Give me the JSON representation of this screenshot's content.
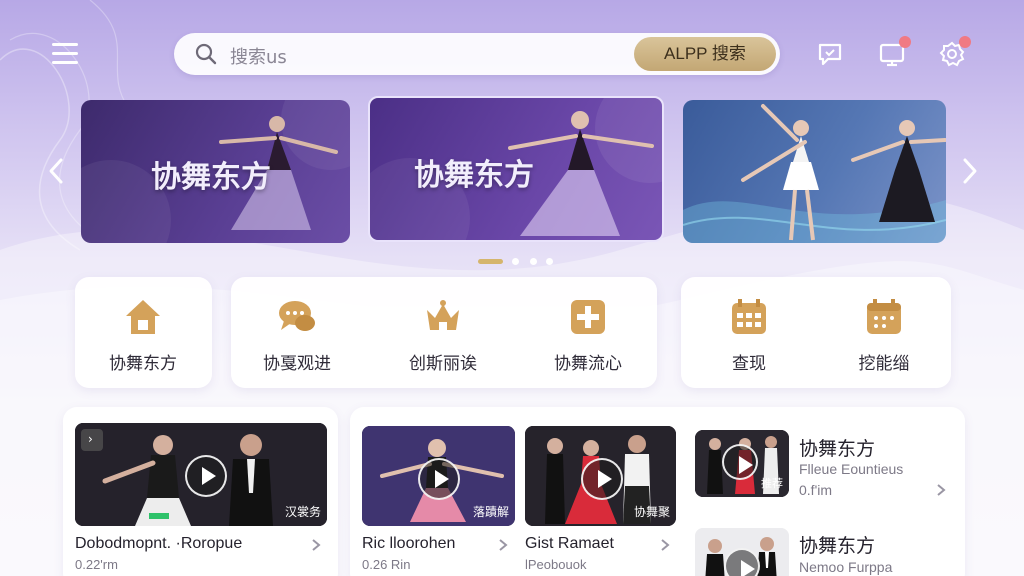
{
  "search": {
    "placeholder": "搜索us",
    "button_label": "ALPP 搜索"
  },
  "header_icons": [
    {
      "name": "chat-icon"
    },
    {
      "name": "tv-icon",
      "badge": ""
    },
    {
      "name": "settings-icon",
      "badge": ""
    }
  ],
  "carousel": {
    "banners": [
      {
        "text": "协舞东方"
      },
      {
        "text": "协舞东方"
      },
      {
        "text": ""
      }
    ],
    "dots": 4,
    "active_dot": 0
  },
  "categories": {
    "group1": [
      {
        "label": "协舞东方",
        "icon": "home-icon"
      }
    ],
    "group2": [
      {
        "label": "协戛观进",
        "icon": "chat-bubbles-icon"
      },
      {
        "label": "创斯丽诶",
        "icon": "crown-icon"
      },
      {
        "label": "协舞流心",
        "icon": "plus-box-icon"
      }
    ],
    "group3": [
      {
        "label": "查现",
        "icon": "calendar-icon"
      },
      {
        "label": "挖能缁",
        "icon": "calendar-grid-icon"
      }
    ]
  },
  "videos": {
    "featured": {
      "tag": "汉裳务",
      "title": "Dobodmopnt. ·Roropue",
      "subtitle": "0.22'rm"
    },
    "grid": [
      {
        "tag": "落蹟解",
        "title": "Ric lloorohen",
        "subtitle": "0.26 Rin"
      },
      {
        "tag": "协舞聚",
        "title": "Gist Ramaet",
        "subtitle": "lPeobouok"
      }
    ],
    "list": [
      {
        "tag": "推荐",
        "title": "协舞东方",
        "subtitle": "Flleue Eountieus",
        "meta": "0.f'im"
      },
      {
        "tag": "",
        "title": "协舞东方",
        "subtitle": "Nemoo Furppa",
        "meta": ""
      }
    ]
  },
  "colors": {
    "accent_gold": "#c9ad7a",
    "icon_gold": "#d2a45a",
    "badge_red": "#f07a83",
    "bg_purple": "#b7a8e6"
  }
}
